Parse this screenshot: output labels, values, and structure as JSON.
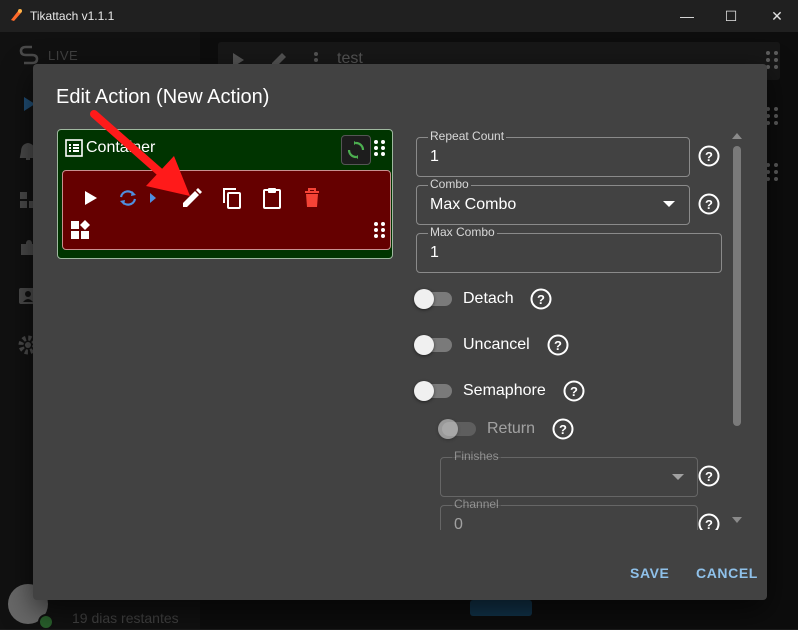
{
  "window": {
    "title": "Tikattach v1.1.1",
    "minimize": "—",
    "maximize": "☐",
    "close": "✕"
  },
  "background": {
    "sidebar_live": "LIVE",
    "row_title": "test",
    "user_status": "19 dias restantes"
  },
  "dialog": {
    "title": "Edit Action (New Action)",
    "container": {
      "label": "Container",
      "toolbar_icons": [
        "play-icon",
        "repeat-icon",
        "chevron-right-icon",
        "edit-icon",
        "copy-icon",
        "paste-icon",
        "delete-icon",
        "widgets-icon"
      ]
    },
    "fields": {
      "repeat_count": {
        "label": "Repeat Count",
        "value": "1"
      },
      "combo": {
        "label": "Combo",
        "value": "Max Combo"
      },
      "max_combo": {
        "label": "Max Combo",
        "value": "1"
      },
      "finishes": {
        "label": "Finishes",
        "value": ""
      },
      "channel": {
        "label": "Channel",
        "value": "0"
      }
    },
    "toggles": {
      "detach": {
        "label": "Detach",
        "on": false
      },
      "uncancel": {
        "label": "Uncancel",
        "on": false
      },
      "semaphore": {
        "label": "Semaphore",
        "on": false
      },
      "return": {
        "label": "Return",
        "on": false,
        "disabled": true
      }
    },
    "actions": {
      "save": "SAVE",
      "cancel": "CANCEL"
    }
  },
  "colors": {
    "accent": "#8fc1ea",
    "container_bg": "#003400",
    "action_bg": "#650000",
    "delete_red": "#f44336",
    "annotation_arrow": "#ff1a1a"
  }
}
